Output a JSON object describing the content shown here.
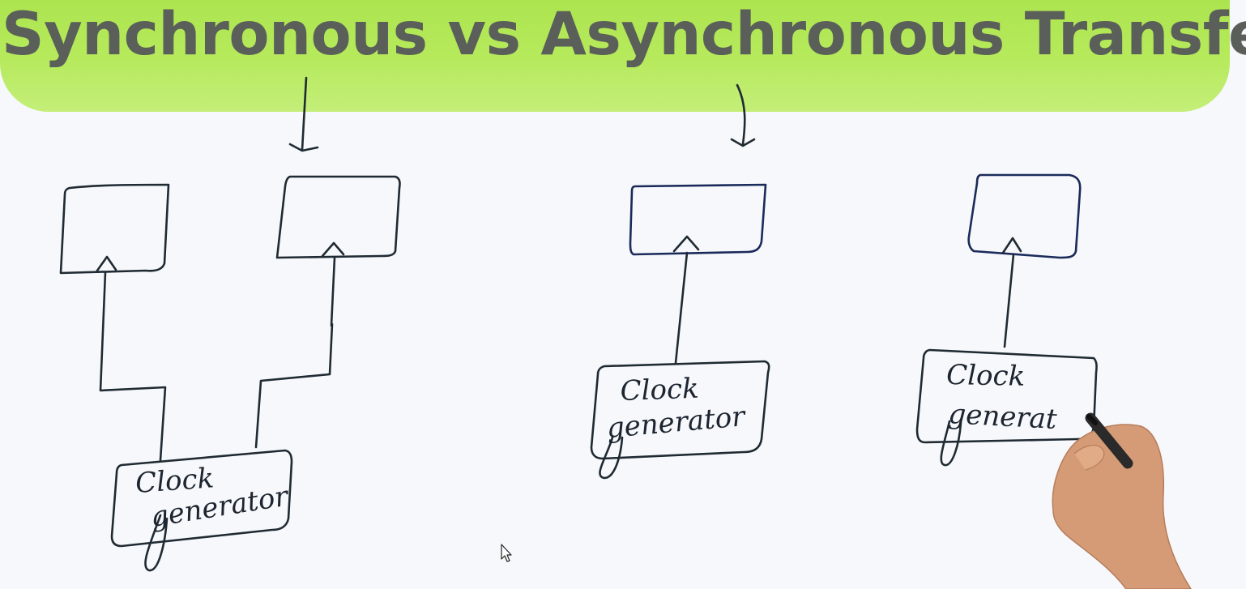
{
  "title": "Synchronous vs Asynchronous Transfer",
  "diagram": {
    "synchronous": {
      "clock_label_line1": "Clock",
      "clock_label_line2": "generator"
    },
    "asynchronous_a": {
      "clock_label_line1": "Clock",
      "clock_label_line2": "generator"
    },
    "asynchronous_b": {
      "clock_label_line1": "Clock",
      "clock_label_line2": "generat"
    }
  },
  "colors": {
    "banner": "#b6ea5c",
    "title_text": "#5a5f59",
    "ink": "#1f2a33",
    "board": "#f7f8fb"
  }
}
